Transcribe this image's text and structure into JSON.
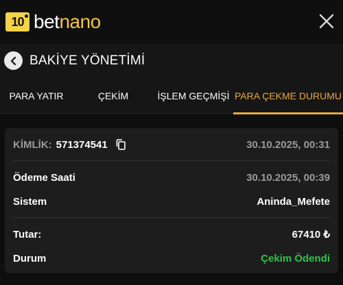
{
  "header": {
    "logo_badge": "10",
    "logo_text_a": "bet",
    "logo_text_b": "nano",
    "close_icon": "close-icon"
  },
  "page": {
    "title": "BAKİYE YÖNETİMİ",
    "back_icon": "chevron-left-icon"
  },
  "tabs": [
    {
      "label": "PARA YATIR",
      "active": false
    },
    {
      "label": "ÇEKİM",
      "active": false
    },
    {
      "label": "İŞLEM GEÇMİŞİ",
      "active": false
    },
    {
      "label": "PARA ÇEKME DURUMU",
      "active": true
    }
  ],
  "card": {
    "id_label": "KİMLİK:",
    "id_value": "571374541",
    "copy_icon": "copy-icon",
    "created_at": "30.10.2025, 00:31",
    "payment_time_label": "Ödeme Saati",
    "payment_time_value": "30.10.2025, 00:39",
    "system_label": "Sistem",
    "system_value": "Aninda_Mefete",
    "amount_label": "Tutar:",
    "amount_value": "67410 ₺",
    "status_label": "Durum",
    "status_value": "Çekim Ödendi"
  },
  "colors": {
    "accent": "#e9a93d",
    "logo_yellow": "#f4c542",
    "success": "#2fc34a",
    "background": "#0e0e0e",
    "panel": "#161616",
    "card": "#1d1d1d"
  }
}
